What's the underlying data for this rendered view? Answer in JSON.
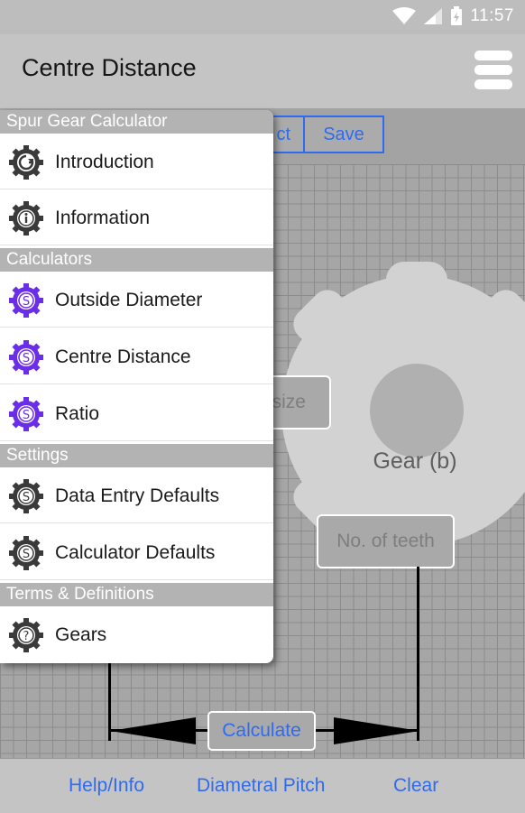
{
  "status_bar": {
    "time": "11:57"
  },
  "app_bar": {
    "title": "Centre Distance",
    "menu_icon": "hamburger-menu-icon"
  },
  "toolbar": {
    "partial_label": "ct",
    "save_label": "Save"
  },
  "diagram": {
    "gear_label": "Gear (b)",
    "size_placeholder": "size",
    "teeth_placeholder": "No. of teeth",
    "calculate_label": "Calculate"
  },
  "bottom_bar": {
    "help_label": "Help/Info",
    "pitch_label": "Diametral Pitch",
    "clear_label": "Clear"
  },
  "drawer": {
    "sections": [
      {
        "header": "Spur Gear Calculator"
      },
      {
        "header": "Calculators"
      },
      {
        "header": "Settings"
      },
      {
        "header": "Terms & Definitions"
      }
    ],
    "items": [
      {
        "label": "Introduction",
        "icon": "gear-arrow-icon",
        "color": "#3a3a3a"
      },
      {
        "label": "Information",
        "icon": "gear-info-icon",
        "color": "#3a3a3a"
      },
      {
        "label": "Outside Diameter",
        "icon": "gear-s-icon",
        "color": "#6a2ee8"
      },
      {
        "label": "Centre Distance",
        "icon": "gear-s-icon",
        "color": "#6a2ee8"
      },
      {
        "label": "Ratio",
        "icon": "gear-s-icon",
        "color": "#6a2ee8"
      },
      {
        "label": "Data Entry Defaults",
        "icon": "gear-s-icon",
        "color": "#3a3a3a"
      },
      {
        "label": "Calculator Defaults",
        "icon": "gear-s-icon",
        "color": "#3a3a3a"
      },
      {
        "label": "Gears",
        "icon": "gear-question-icon",
        "color": "#3a3a3a"
      }
    ]
  },
  "colors": {
    "accent": "#2f6bf0",
    "calculator_icon": "#6a2ee8",
    "section_header": "#b3b3b3"
  }
}
